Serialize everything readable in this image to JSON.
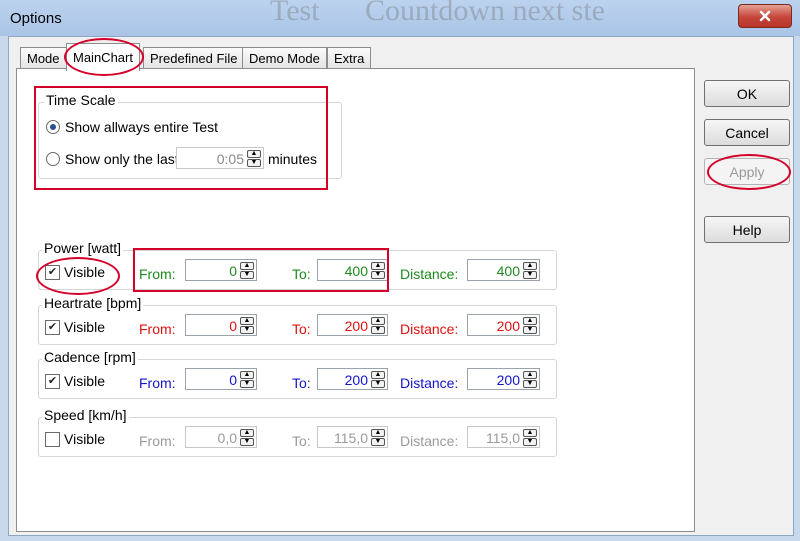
{
  "window": {
    "title": "Options",
    "background_text_1": "Test",
    "background_text_2": "Countdown next ste"
  },
  "tabs": [
    {
      "label": "Mode"
    },
    {
      "label": "MainChart"
    },
    {
      "label": "Predefined File"
    },
    {
      "label": "Demo Mode"
    },
    {
      "label": "Extra"
    }
  ],
  "buttons": {
    "ok": "OK",
    "cancel": "Cancel",
    "apply": "Apply",
    "help": "Help"
  },
  "time_scale": {
    "title": "Time Scale",
    "option_entire": "Show allways entire Test",
    "option_last": "Show only the last",
    "last_value": "0:05",
    "unit": "minutes",
    "selected": "entire"
  },
  "labels": {
    "visible": "Visible",
    "from": "From:",
    "to": "To:",
    "distance": "Distance:"
  },
  "series": [
    {
      "name": "Power [watt]",
      "visible": true,
      "from": "0",
      "to": "400",
      "distance": "400",
      "color": "#1e8a1e"
    },
    {
      "name": "Heartrate [bpm]",
      "visible": true,
      "from": "0",
      "to": "200",
      "distance": "200",
      "color": "#e01010"
    },
    {
      "name": "Cadence [rpm]",
      "visible": true,
      "from": "0",
      "to": "200",
      "distance": "200",
      "color": "#1414c8"
    },
    {
      "name": "Speed [km/h]",
      "visible": false,
      "from": "0,0",
      "to": "115,0",
      "distance": "115,0",
      "color": "#9a9a9a"
    }
  ],
  "colors": {
    "annotation": "#d4002a"
  }
}
